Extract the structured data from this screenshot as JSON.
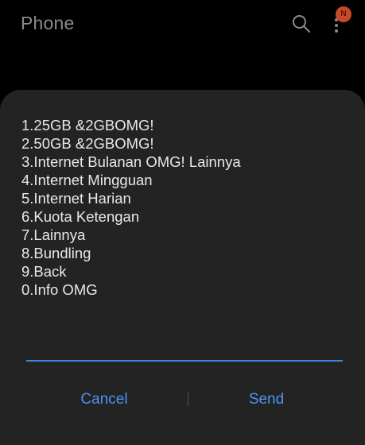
{
  "app_bar": {
    "title": "Phone",
    "search_icon": "search-icon",
    "more_icon": "more-vertical-icon",
    "badge_text": "N",
    "badge_color": "#c8482a"
  },
  "dialog": {
    "menu_items": [
      "1.25GB &2GBOMG!",
      "2.50GB &2GBOMG!",
      "3.Internet Bulanan OMG! Lainnya",
      "4.Internet Mingguan",
      "5.Internet Harian",
      "6.Kuota Ketengan",
      "7.Lainnya",
      "8.Bundling",
      "9.Back",
      "0.Info OMG"
    ],
    "input_value": "",
    "cancel_label": "Cancel",
    "send_label": "Send",
    "accent_color": "#4a93f0"
  }
}
